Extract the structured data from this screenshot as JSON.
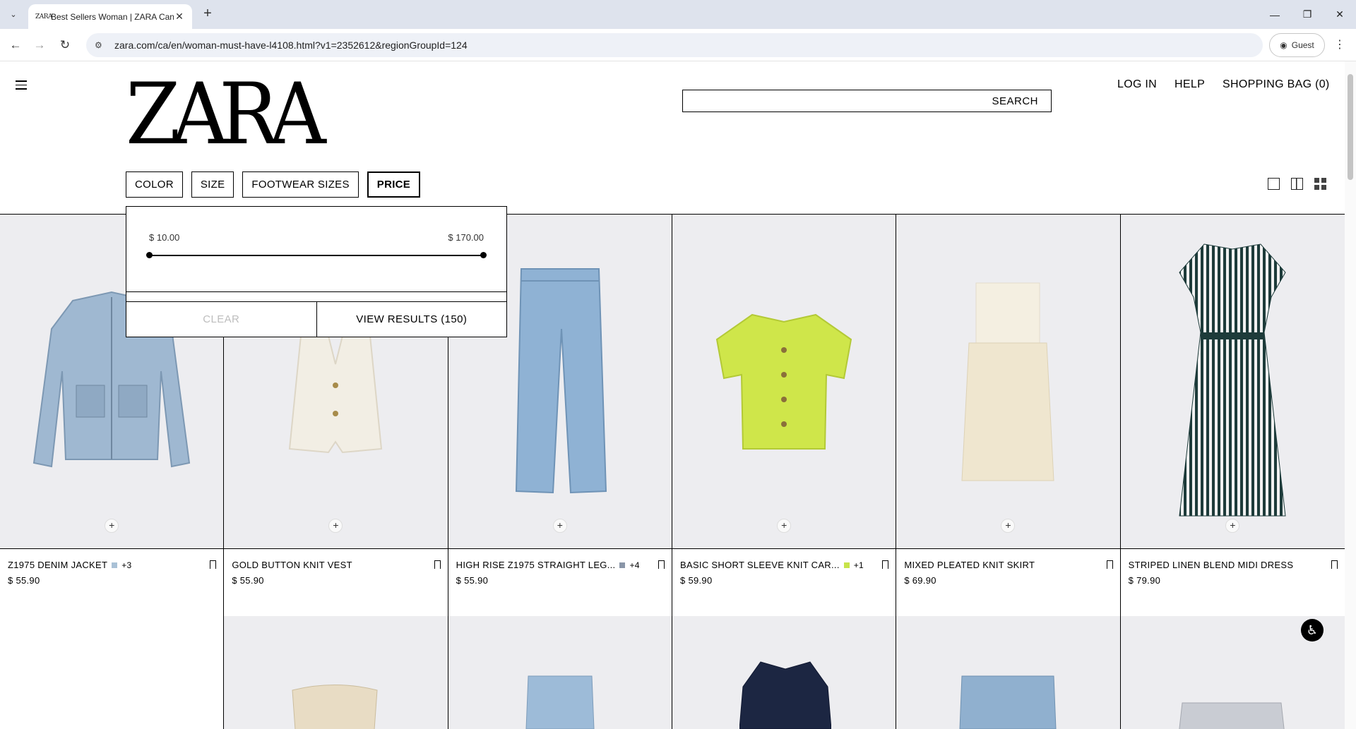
{
  "browser": {
    "tab_title": "Best Sellers Woman | ZARA Canada",
    "favicon_text": "ZARA",
    "url": "zara.com/ca/en/woman-must-have-l4108.html?v1=2352612&regionGroupId=124",
    "profile_label": "Guest"
  },
  "header": {
    "logo": "ZARA",
    "search_label": "SEARCH",
    "links": [
      "LOG IN",
      "HELP",
      "SHOPPING BAG (0)"
    ]
  },
  "filters": [
    "COLOR",
    "SIZE",
    "FOOTWEAR SIZES",
    "PRICE"
  ],
  "price_filter": {
    "min_label": "$ 10.00",
    "max_label": "$ 170.00",
    "clear_label": "CLEAR",
    "view_results_label": "VIEW RESULTS (150)"
  },
  "products": [
    {
      "name": "Z1975 DENIM JACKET",
      "price": "$ 55.90",
      "swatch_color": "#a9c1d6",
      "more": "+3"
    },
    {
      "name": "GOLD BUTTON KNIT VEST",
      "price": "$ 55.90",
      "swatch_color": "",
      "more": ""
    },
    {
      "name": "HIGH RISE Z1975 STRAIGHT LEG...",
      "price": "$ 55.90",
      "swatch_color": "#8a96a8",
      "more": "+4"
    },
    {
      "name": "BASIC SHORT SLEEVE KNIT CAR...",
      "price": "$ 59.90",
      "swatch_color": "#c7e34a",
      "more": "+1"
    },
    {
      "name": "MIXED PLEATED KNIT SKIRT",
      "price": "$ 69.90",
      "swatch_color": "",
      "more": ""
    },
    {
      "name": "STRIPED LINEN BLEND MIDI DRESS",
      "price": "$ 79.90",
      "swatch_color": "",
      "more": ""
    }
  ],
  "icons": {
    "menu": "hamburger-icon",
    "view_single": "view-single-icon",
    "view_double": "view-double-icon",
    "view_grid": "view-grid-icon",
    "accessibility": "accessibility-icon",
    "bookmark": "bookmark-icon"
  }
}
